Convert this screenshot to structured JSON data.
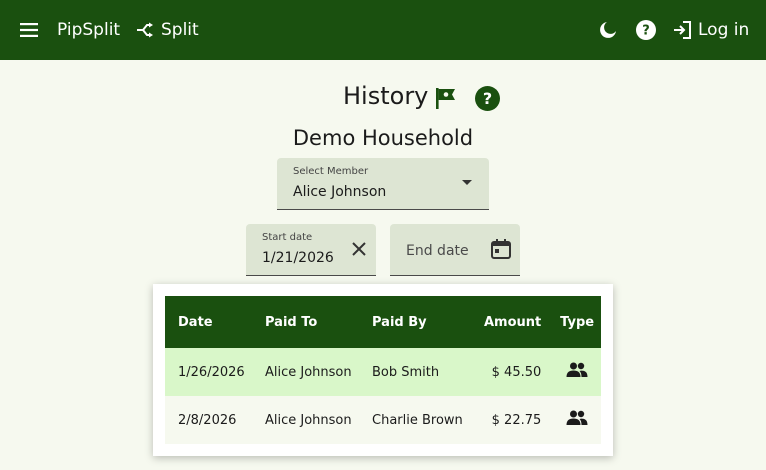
{
  "header": {
    "brand": "PipSplit",
    "split_label": "Split",
    "login_label": "Log in",
    "icons": [
      "menu-icon",
      "split-icon",
      "moon-icon",
      "help-icon",
      "login-icon"
    ]
  },
  "page": {
    "title": "History",
    "household": "Demo Household"
  },
  "filters": {
    "member": {
      "label": "Select Member",
      "value": "Alice Johnson"
    },
    "start_date": {
      "label": "Start date",
      "value": "1/21/2026"
    },
    "end_date": {
      "placeholder": "End date"
    }
  },
  "table": {
    "headers": [
      "Date",
      "Paid To",
      "Paid By",
      "Amount",
      "Type"
    ],
    "rows": [
      {
        "date": "1/26/2026",
        "paid_to": "Alice Johnson",
        "paid_by": "Bob Smith",
        "amount": "$ 45.50",
        "type_icon": "group-icon"
      },
      {
        "date": "2/8/2026",
        "paid_to": "Alice Johnson",
        "paid_by": "Charlie Brown",
        "amount": "$ 22.75",
        "type_icon": "group-icon"
      }
    ]
  },
  "colors": {
    "primary": "#1a500f",
    "background": "#f6f9ef",
    "field_bg": "#dde5d3",
    "row_highlight": "#d9f7c9"
  }
}
